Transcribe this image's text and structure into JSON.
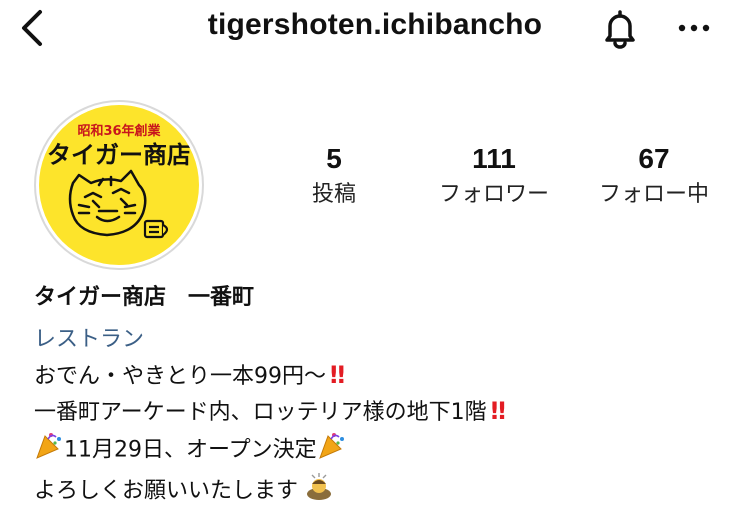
{
  "header": {
    "username": "tigershoten.ichibancho",
    "icons": [
      "back-chevron-icon",
      "bell-icon",
      "more-icon"
    ]
  },
  "avatar": {
    "top_text": "昭和36年創業",
    "main_text": "タイガー商店",
    "background_color": "#fde42b"
  },
  "stats": {
    "posts_count": "5",
    "posts_label": "投稿",
    "followers_count": "111",
    "followers_label": "フォロワー",
    "following_count": "67",
    "following_label": "フォロー中"
  },
  "bio": {
    "name": "タイガー商店　一番町",
    "category": "レストラン",
    "line1": "おでん・やきとり一本99円〜",
    "line2": "一番町アーケード内、ロッテリア様の地下1階",
    "line3": "11月29日、オープン決定",
    "line4": "よろしくお願いいたします",
    "exclaim": "‼",
    "emoji_names": [
      "double-exclamation-icon",
      "party-popper-icon",
      "bowing-person-icon"
    ]
  },
  "colors": {
    "link": "#3b5f86",
    "exclaim": "#e31c23"
  }
}
